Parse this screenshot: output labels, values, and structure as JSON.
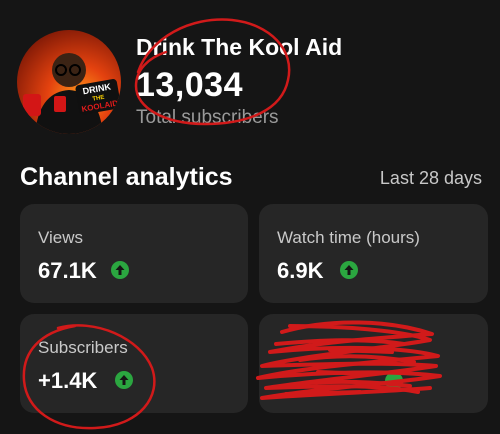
{
  "channel": {
    "name": "Drink The Kool Aid",
    "subscriber_count": "13,034",
    "subscriber_label": "Total subscribers",
    "avatar_logo_text": [
      "DRINK",
      "THE",
      "KOOLAID"
    ]
  },
  "analytics": {
    "title": "Channel analytics",
    "period": "Last 28 days",
    "cards": [
      {
        "label": "Views",
        "value": "67.1K",
        "trend": "up"
      },
      {
        "label": "Watch time (hours)",
        "value": "6.9K",
        "trend": "up"
      },
      {
        "label": "Subscribers",
        "value": "+1.4K",
        "trend": "up"
      },
      {
        "label": "",
        "value": "",
        "trend": "up",
        "obscured": true
      }
    ]
  },
  "colors": {
    "background": "#151515",
    "card": "#262626",
    "trend_up": "#2ba640",
    "annotation": "#d11a1a"
  }
}
